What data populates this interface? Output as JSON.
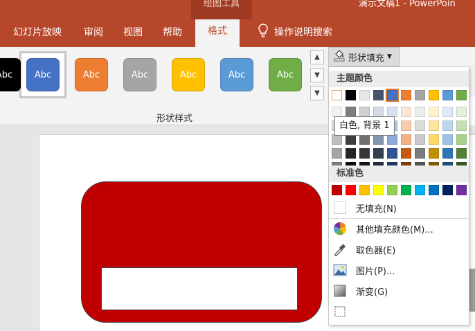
{
  "titlebar": {
    "contextual_tab_group": "绘图工具",
    "document_title": "演示文稿1 - PowerPoin",
    "tabs": [
      "幻灯片放映",
      "审阅",
      "视图",
      "帮助",
      "格式"
    ],
    "active_tab": "格式",
    "tell_me": "操作说明搜索",
    "bg_color": "#b7472a"
  },
  "ribbon": {
    "shape_styles": [
      {
        "label": "Abc",
        "color": "#000000"
      },
      {
        "label": "Abc",
        "color": "#4472c4"
      },
      {
        "label": "Abc",
        "color": "#ed7d31"
      },
      {
        "label": "Abc",
        "color": "#a5a5a5"
      },
      {
        "label": "Abc",
        "color": "#ffc000"
      },
      {
        "label": "Abc",
        "color": "#5b9bd5"
      },
      {
        "label": "Abc",
        "color": "#70ad47"
      }
    ],
    "group_label": "形状样式",
    "shape_fill_button": "形状填充"
  },
  "fill_menu": {
    "theme_colors_header": "主题颜色",
    "standard_colors_header": "标准色",
    "tooltip": "白色, 背景 1",
    "theme_top_row": [
      "#ffffff",
      "#000000",
      "#e7e6e6",
      "#44546a",
      "#4472c4",
      "#ed7d31",
      "#a5a5a5",
      "#ffc000",
      "#5b9bd5",
      "#70ad47"
    ],
    "theme_shades": [
      [
        "#f2f2f2",
        "#7f7f7f",
        "#d0cece",
        "#d6dce4",
        "#d9e2f3",
        "#fbe5d5",
        "#ededed",
        "#fff2cc",
        "#deebf6",
        "#e2efd9"
      ],
      [
        "#d8d8d8",
        "#595959",
        "#aeabab",
        "#adb9ca",
        "#b4c6e7",
        "#f7cbac",
        "#dbdbdb",
        "#fee599",
        "#bdd7ee",
        "#c5e0b3"
      ],
      [
        "#bfbfbf",
        "#3f3f3f",
        "#757070",
        "#8496b0",
        "#8eaadb",
        "#f4b183",
        "#c9c9c9",
        "#ffd965",
        "#9cc3e5",
        "#a8d08d"
      ],
      [
        "#a5a5a5",
        "#262626",
        "#3a3838",
        "#323f4f",
        "#2f5496",
        "#c55a11",
        "#7b7b7b",
        "#bf9000",
        "#2e75b5",
        "#538135"
      ],
      [
        "#7f7f7f",
        "#0c0c0c",
        "#171616",
        "#222a35",
        "#1f3864",
        "#833c0b",
        "#525252",
        "#7f6000",
        "#1e4e79",
        "#375623"
      ]
    ],
    "standard_colors": [
      "#c00000",
      "#ff0000",
      "#ffc000",
      "#ffff00",
      "#92d050",
      "#00b050",
      "#00b0f0",
      "#0070c0",
      "#002060",
      "#7030a0"
    ],
    "items": {
      "no_fill": "无填充(N)",
      "more_colors": "其他填充颜色(M)...",
      "eyedropper": "取色器(E)",
      "picture": "图片(P)...",
      "gradient": "渐变(G)"
    }
  },
  "slide": {
    "shape_fill": "#c00000"
  }
}
